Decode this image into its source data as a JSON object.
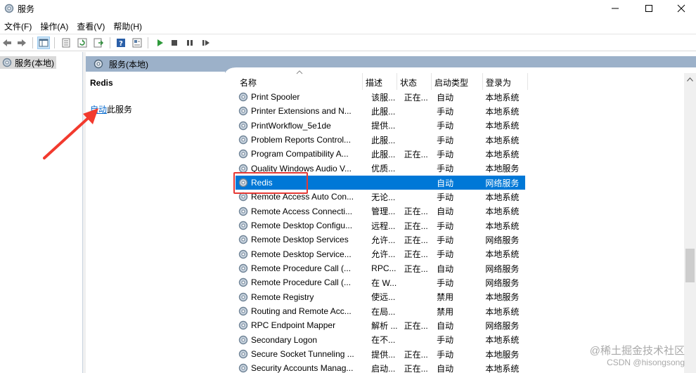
{
  "window": {
    "title": "服务"
  },
  "menu": [
    "文件(F)",
    "操作(A)",
    "查看(V)",
    "帮助(H)"
  ],
  "tree": {
    "root_label": "服务(本地)"
  },
  "pane": {
    "header": "服务(本地)",
    "selected_service": "Redis",
    "action_link": "启动",
    "action_suffix": "此服务"
  },
  "columns": [
    "名称",
    "描述",
    "状态",
    "启动类型",
    "登录为"
  ],
  "services": [
    {
      "name": "Print Spooler",
      "desc": "该服...",
      "status": "正在...",
      "startup": "自动",
      "logon": "本地系统"
    },
    {
      "name": "Printer Extensions and N...",
      "desc": "此服...",
      "status": "",
      "startup": "手动",
      "logon": "本地系统"
    },
    {
      "name": "PrintWorkflow_5e1de",
      "desc": "提供...",
      "status": "",
      "startup": "手动",
      "logon": "本地系统"
    },
    {
      "name": "Problem Reports Control...",
      "desc": "此服...",
      "status": "",
      "startup": "手动",
      "logon": "本地系统"
    },
    {
      "name": "Program Compatibility A...",
      "desc": "此服...",
      "status": "正在...",
      "startup": "手动",
      "logon": "本地系统"
    },
    {
      "name": "Quality Windows Audio V...",
      "desc": "优质...",
      "status": "",
      "startup": "手动",
      "logon": "本地服务"
    },
    {
      "name": "Redis",
      "desc": "",
      "status": "",
      "startup": "自动",
      "logon": "网络服务"
    },
    {
      "name": "Remote Access Auto Con...",
      "desc": "无论...",
      "status": "",
      "startup": "手动",
      "logon": "本地系统"
    },
    {
      "name": "Remote Access Connecti...",
      "desc": "管理...",
      "status": "正在...",
      "startup": "自动",
      "logon": "本地系统"
    },
    {
      "name": "Remote Desktop Configu...",
      "desc": "远程...",
      "status": "正在...",
      "startup": "手动",
      "logon": "本地系统"
    },
    {
      "name": "Remote Desktop Services",
      "desc": "允许...",
      "status": "正在...",
      "startup": "手动",
      "logon": "网络服务"
    },
    {
      "name": "Remote Desktop Service...",
      "desc": "允许...",
      "status": "正在...",
      "startup": "手动",
      "logon": "本地系统"
    },
    {
      "name": "Remote Procedure Call (...",
      "desc": "RPC...",
      "status": "正在...",
      "startup": "自动",
      "logon": "网络服务"
    },
    {
      "name": "Remote Procedure Call (...",
      "desc": "在 W...",
      "status": "",
      "startup": "手动",
      "logon": "网络服务"
    },
    {
      "name": "Remote Registry",
      "desc": "使远...",
      "status": "",
      "startup": "禁用",
      "logon": "本地服务"
    },
    {
      "name": "Routing and Remote Acc...",
      "desc": "在局...",
      "status": "",
      "startup": "禁用",
      "logon": "本地系统"
    },
    {
      "name": "RPC Endpoint Mapper",
      "desc": "解析 ...",
      "status": "正在...",
      "startup": "自动",
      "logon": "网络服务"
    },
    {
      "name": "Secondary Logon",
      "desc": "在不...",
      "status": "",
      "startup": "手动",
      "logon": "本地系统"
    },
    {
      "name": "Secure Socket Tunneling ...",
      "desc": "提供...",
      "status": "正在...",
      "startup": "手动",
      "logon": "本地服务"
    },
    {
      "name": "Security Accounts Manag...",
      "desc": "启动...",
      "status": "正在...",
      "startup": "自动",
      "logon": "本地系统"
    }
  ],
  "selected_index": 6,
  "watermark": {
    "line1": "@稀土掘金技术社区",
    "line2": "CSDN @hisongsong"
  },
  "colors": {
    "selection": "#0078d7",
    "header_band": "#9cb1c9",
    "annotation": "#e53935",
    "link": "#0066cc"
  },
  "icons": [
    "services-gear-icon",
    "back-arrow-icon",
    "forward-arrow-icon",
    "show-hide-tree-icon",
    "properties-icon",
    "refresh-icon",
    "export-icon",
    "help-icon",
    "view-icon",
    "play-icon",
    "stop-icon",
    "pause-icon",
    "resume-icon"
  ]
}
